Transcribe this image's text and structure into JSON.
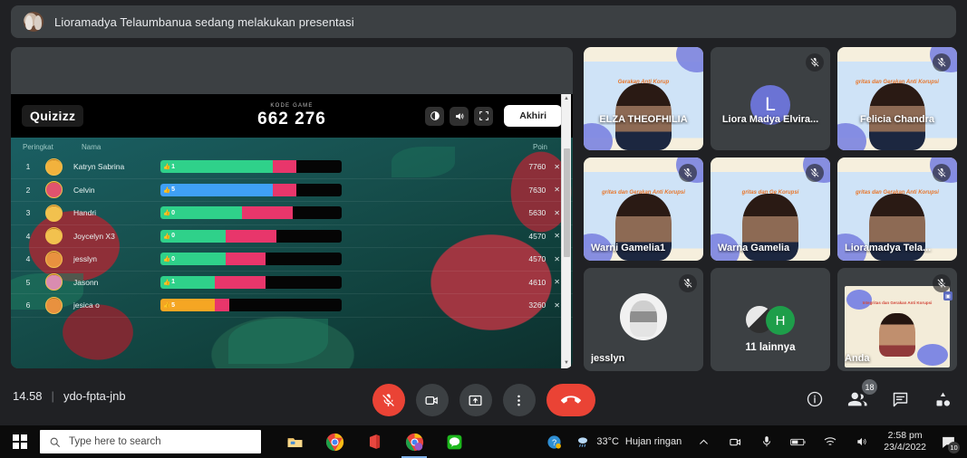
{
  "banner": {
    "text": "Lioramadya Telaumbanua sedang melakukan presentasi",
    "avatar_icon": "participant-avatar-icon"
  },
  "quizizz": {
    "logo": "Quizizz",
    "code_label": "KODE GAME",
    "code_value": "662 276",
    "end_button": "Akhiri",
    "tool_icons": [
      "theme-icon",
      "volume-icon",
      "fullscreen-icon"
    ],
    "columns": {
      "rank": "Peringkat",
      "name": "Nama",
      "points": "Poin"
    },
    "rows": [
      {
        "rank": "1",
        "name": "Katryn Sabrina",
        "correct": "1",
        "points": "7760",
        "correct_pct": 62,
        "wrong_pct": 13,
        "bar_color": "#2fd18a",
        "avatar_color": "#f2b23d"
      },
      {
        "rank": "2",
        "name": "Celvin",
        "correct": "5",
        "points": "7630",
        "correct_pct": 62,
        "wrong_pct": 13,
        "bar_color": "#3fa0f5",
        "avatar_color": "#e0536e"
      },
      {
        "rank": "3",
        "name": "Handri",
        "correct": "0",
        "points": "5630",
        "correct_pct": 45,
        "wrong_pct": 28,
        "bar_color": "#2fd18a",
        "avatar_color": "#f2c14e"
      },
      {
        "rank": "4",
        "name": "Joycelyn X3",
        "correct": "0",
        "points": "4570",
        "correct_pct": 36,
        "wrong_pct": 28,
        "bar_color": "#2fd18a",
        "avatar_color": "#f2c14e"
      },
      {
        "rank": "4",
        "name": "jesslyn",
        "correct": "0",
        "points": "4570",
        "correct_pct": 36,
        "wrong_pct": 22,
        "bar_color": "#2fd18a",
        "avatar_color": "#e8913f"
      },
      {
        "rank": "5",
        "name": "Jasonn",
        "correct": "1",
        "points": "4610",
        "correct_pct": 30,
        "wrong_pct": 28,
        "bar_color": "#2fd18a",
        "avatar_color": "#d98cb0"
      },
      {
        "rank": "6",
        "name": "jesica o",
        "correct": "5",
        "points": "3260",
        "correct_pct": 30,
        "wrong_pct": 8,
        "bar_color": "#f5a623",
        "avatar_color": "#e8913f"
      }
    ],
    "remove_icon": "remove-player-icon",
    "thumb_icon": "thumbs-up-icon",
    "scrollbar": "share-screen-scrollbar"
  },
  "tiles": [
    {
      "name": "ELZA THEOFHILIA",
      "type": "video",
      "muted": false,
      "slide_title": "Gerakan Anti Korup",
      "name_centered": true
    },
    {
      "name": "Liora Madya Elvira...",
      "type": "initial",
      "initial": "L",
      "muted": true,
      "name_centered": true
    },
    {
      "name": "Felicia Chandra",
      "type": "video",
      "muted": true,
      "slide_title": "gritas dan Gerakan Anti Korupsi",
      "name_centered": true
    },
    {
      "name": "Warni Gamelia1",
      "type": "video",
      "muted": true,
      "slide_title": "gritas dan Gerakan Anti Korupsi",
      "name_centered": false
    },
    {
      "name": "Warna Gamelia",
      "type": "video",
      "muted": true,
      "slide_title": "gritas dan Ge          Korupsi",
      "name_centered": false
    },
    {
      "name": "Lioramadya Tela...",
      "type": "video",
      "muted": true,
      "slide_title": "gritas dan Gerakan Anti Korupsi",
      "name_centered": false
    },
    {
      "name": "jesslyn",
      "type": "photo",
      "muted": true,
      "name_centered": false
    },
    {
      "name": "11 lainnya",
      "type": "more",
      "more_initial": "H",
      "muted": false,
      "name_centered": true
    },
    {
      "name": "Anda",
      "type": "presenting",
      "muted": true,
      "slide_title": "Integritas dan Gerakan Anti Korupsi",
      "name_centered": false
    }
  ],
  "meeting_bar": {
    "time": "14.58",
    "separator": "|",
    "code": "ydo-fpta-jnb",
    "controls": [
      {
        "name": "microphone-off-button",
        "icon": "mic-off-icon",
        "state": "muted"
      },
      {
        "name": "camera-button",
        "icon": "camera-icon",
        "state": "on"
      },
      {
        "name": "present-button",
        "icon": "present-screen-icon",
        "state": "on"
      },
      {
        "name": "more-options-button",
        "icon": "more-vertical-icon",
        "state": "on"
      },
      {
        "name": "hang-up-button",
        "icon": "end-call-icon",
        "state": "danger"
      }
    ],
    "right_icons": [
      {
        "name": "meeting-details-button",
        "icon": "info-icon"
      },
      {
        "name": "participants-button",
        "icon": "people-icon",
        "badge": "18"
      },
      {
        "name": "chat-button",
        "icon": "chat-icon"
      },
      {
        "name": "activities-button",
        "icon": "activities-icon"
      }
    ]
  },
  "taskbar": {
    "start_icon": "windows-start-icon",
    "search_placeholder": "Type here to search",
    "search_icon": "search-icon",
    "apps": [
      {
        "name": "file-explorer-icon",
        "glyph": "folder"
      },
      {
        "name": "google-chrome-icon",
        "glyph": "chrome"
      },
      {
        "name": "microsoft-office-icon",
        "glyph": "office"
      },
      {
        "name": "chrome-meet-icon",
        "glyph": "chrome-alt"
      },
      {
        "name": "line-messenger-icon",
        "glyph": "line"
      }
    ],
    "tray": {
      "help_icon": "help-icon",
      "weather_icon": "weather-rain-icon",
      "temperature": "33°C",
      "weather_text": "Hujan ringan",
      "chevron_icon": "show-hidden-icons-icon",
      "tray_icons": [
        "meet-tray-icon",
        "microphone-tray-icon",
        "battery-icon",
        "wifi-icon",
        "volume-icon"
      ],
      "time": "2:58 pm",
      "date": "23/4/2022",
      "notification_icon": "notifications-icon",
      "notification_count": "10"
    }
  }
}
